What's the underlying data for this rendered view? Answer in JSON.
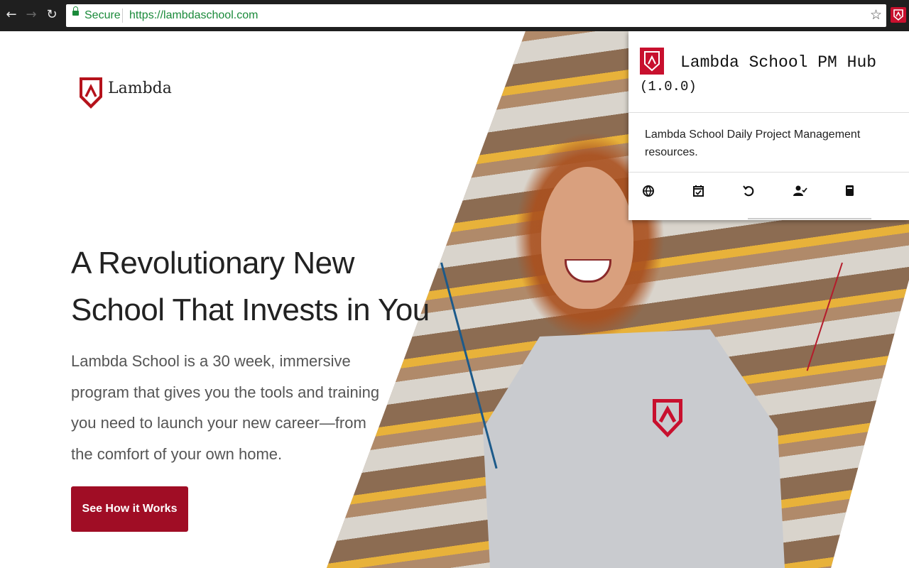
{
  "browser": {
    "secure_label": "Secure",
    "url": "https://lambdaschool.com"
  },
  "page": {
    "logo_text": "Lambda",
    "headline": "A Revolutionary New School That Invests in You",
    "blurb": "Lambda School is a 30 week, immersive program that gives you the tools and training you need to launch your new career—from the comfort of your own home.",
    "cta_label": "See How it Works"
  },
  "popup": {
    "title": "Lambda School PM Hub",
    "version": "(1.0.0)",
    "description": "Lambda School Daily Project Management resources.",
    "icons": [
      "globe-icon",
      "calendar-check-icon",
      "undo-icon",
      "user-check-icon",
      "book-icon"
    ]
  },
  "colors": {
    "brand_red": "#a00d25",
    "secure_green": "#1a8a3a"
  }
}
